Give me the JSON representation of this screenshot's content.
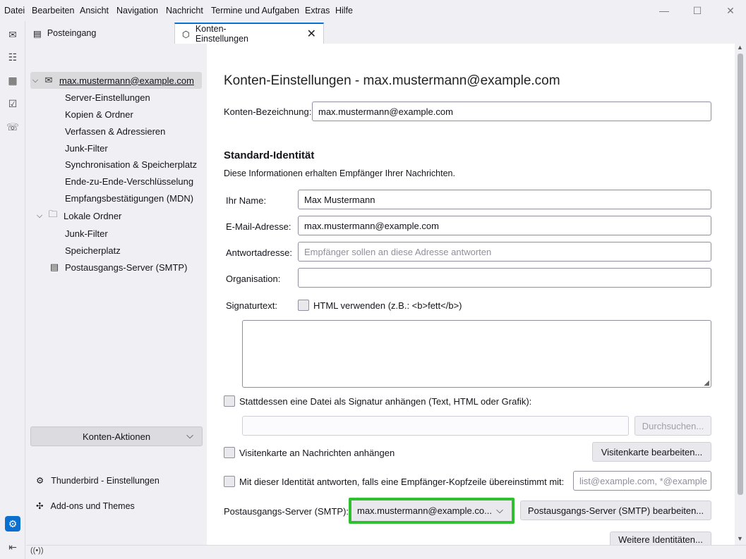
{
  "menu": [
    "Datei",
    "Bearbeiten",
    "Ansicht",
    "Navigation",
    "Nachricht",
    "Termine und Aufgaben",
    "Extras",
    "Hilfe"
  ],
  "tabs": [
    {
      "label": "Posteingang"
    },
    {
      "label": "Konten-Einstellungen"
    }
  ],
  "sidebar": {
    "account": "max.mustermann@example.com",
    "account_items": [
      "Server-Einstellungen",
      "Kopien & Ordner",
      "Verfassen & Adressieren",
      "Junk-Filter",
      "Synchronisation & Speicherplatz",
      "Ende-zu-Ende-Verschlüsselung",
      "Empfangsbestätigungen (MDN)"
    ],
    "local_folders": "Lokale Ordner",
    "local_items": [
      "Junk-Filter",
      "Speicherplatz"
    ],
    "smtp": "Postausgangs-Server (SMTP)",
    "account_actions": "Konten-Aktionen",
    "settings_link": "Thunderbird - Einstellungen",
    "addons_link": "Add-ons und Themes"
  },
  "main": {
    "title": "Konten-Einstellungen - max.mustermann@example.com",
    "account_name_label": "Konten-Bezeichnung:",
    "account_name_value": "max.mustermann@example.com",
    "identity_heading": "Standard-Identität",
    "identity_desc": "Diese Informationen erhalten Empfänger Ihrer Nachrichten.",
    "name_label": "Ihr Name:",
    "name_value": "Max Mustermann",
    "email_label": "E-Mail-Adresse:",
    "email_value": "max.mustermann@example.com",
    "reply_label": "Antwortadresse:",
    "reply_placeholder": "Empfänger sollen an diese Adresse antworten",
    "org_label": "Organisation:",
    "org_value": "",
    "sig_label": "Signaturtext:",
    "sig_html_label": "HTML verwenden (z.B.: <b>fett</b>)",
    "sig_file_label": "Stattdessen eine Datei als Signatur anhängen (Text, HTML oder Grafik):",
    "browse_button": "Durchsuchen...",
    "vcard_label": "Visitenkarte an Nachrichten anhängen",
    "vcard_button": "Visitenkarte bearbeiten...",
    "reply_identity_label": "Mit dieser Identität antworten, falls eine Empfänger-Kopfzeile übereinstimmt mit:",
    "reply_identity_placeholder": "list@example.com, *@example",
    "smtp_label": "Postausgangs-Server (SMTP):",
    "smtp_value": "max.mustermann@example.co...",
    "smtp_button": "Postausgangs-Server (SMTP) bearbeiten...",
    "more_identities_button": "Weitere Identitäten..."
  },
  "colors": {
    "accent": "#0b6fd0",
    "highlight": "#2fbf2f"
  }
}
